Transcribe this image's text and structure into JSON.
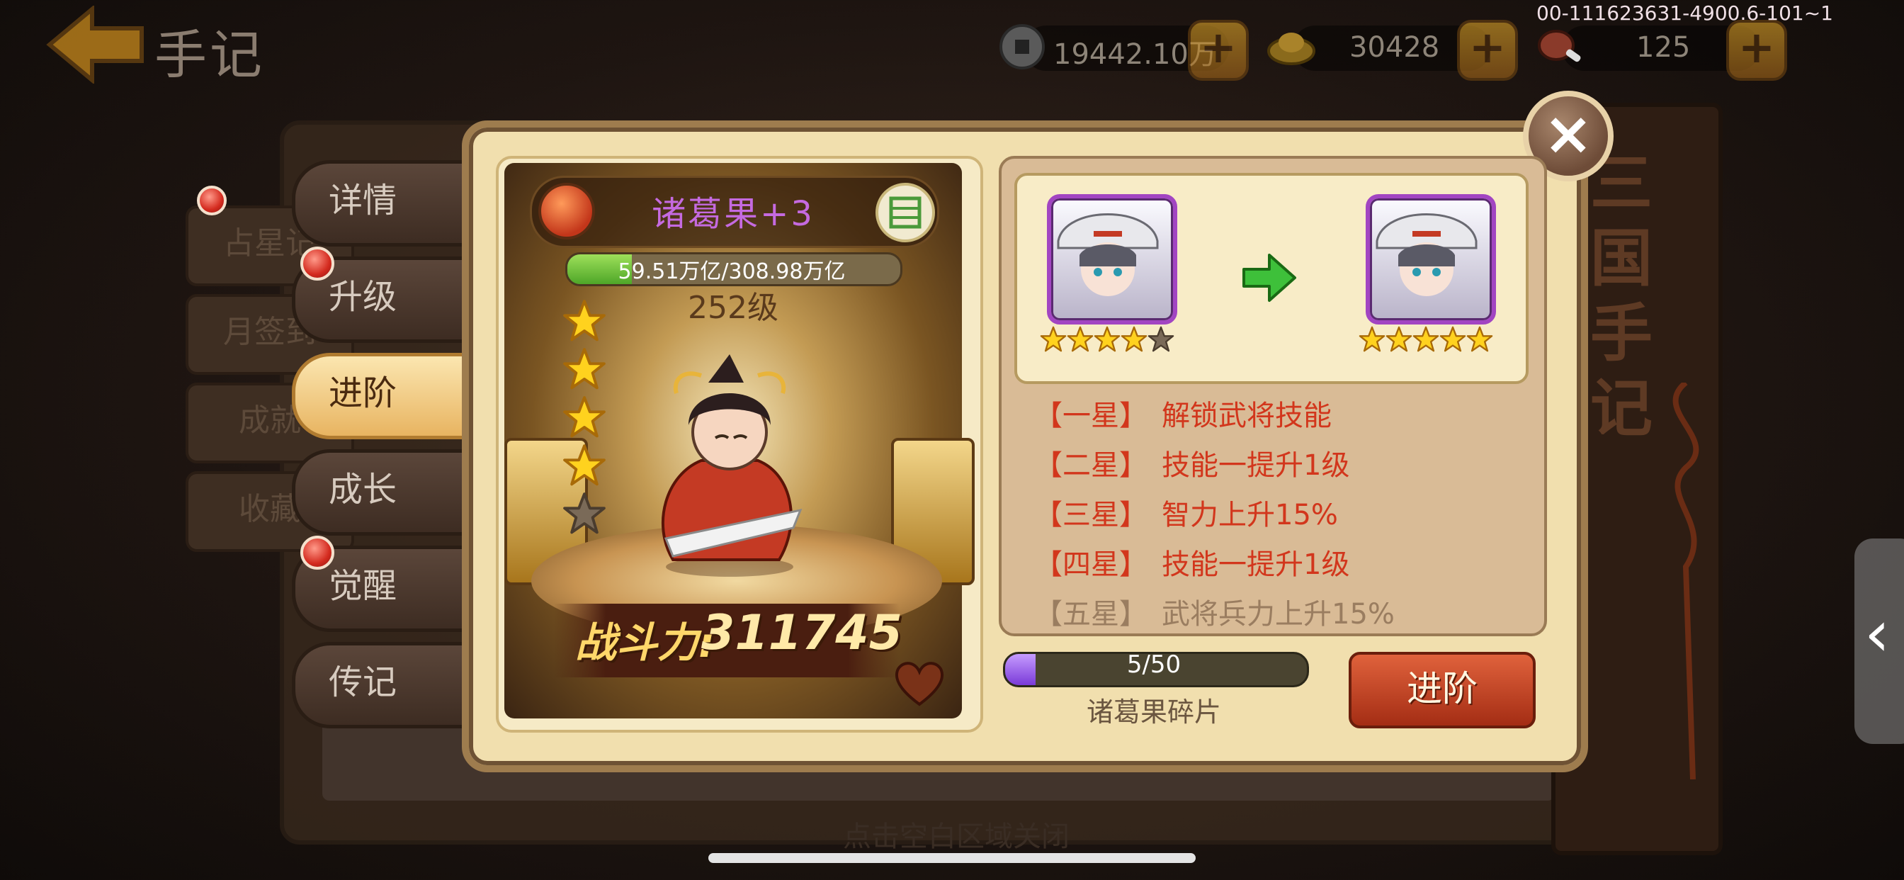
{
  "top_bar": {
    "title": "手记",
    "version": "00-111623631-4900.6-101~1",
    "resources": [
      {
        "icon": "copper-coin-icon",
        "value": "19442.10万"
      },
      {
        "icon": "gold-ingot-icon",
        "value": "30428"
      },
      {
        "icon": "meat-stamina-icon",
        "value": "125"
      }
    ]
  },
  "book": {
    "side_title": "三国手记"
  },
  "back_tabs": [
    "占星记",
    "月签到",
    "成就",
    "收藏"
  ],
  "side_tabs": [
    {
      "label": "详情",
      "active": false,
      "badge": false
    },
    {
      "label": "升级",
      "active": false,
      "badge": true
    },
    {
      "label": "进阶",
      "active": true,
      "badge": false
    },
    {
      "label": "成长",
      "active": false,
      "badge": false
    },
    {
      "label": "觉醒",
      "active": false,
      "badge": true
    },
    {
      "label": "传记",
      "active": false,
      "badge": false
    }
  ],
  "hero": {
    "name": "诸葛果+3",
    "exp_text": "59.51万亿/308.98万亿",
    "exp_fraction": 0.193,
    "level": "252级",
    "stars_current": 4,
    "power_label": "战斗力:",
    "power_value": "311745"
  },
  "advance": {
    "from_stars": 4,
    "to_stars": 5,
    "star_total": 5,
    "skills": [
      {
        "tag": "【一星】",
        "desc": "解锁武将技能"
      },
      {
        "tag": "【二星】",
        "desc": "技能一提升1级"
      },
      {
        "tag": "【三星】",
        "desc": "智力上升15%"
      },
      {
        "tag": "【四星】",
        "desc": "技能一提升1级"
      },
      {
        "tag": "【五星】",
        "desc": "武将兵力上升15%"
      }
    ],
    "fragment_text": "5/50",
    "fragment_fraction": 0.1,
    "fragment_label": "诸葛果碎片",
    "button": "进阶"
  },
  "close_hint": "点击空白区域关闭",
  "colors": {
    "skill_text": "#d2361c",
    "hero_name": "#c56ae0",
    "accent_button": "#c0401e"
  }
}
